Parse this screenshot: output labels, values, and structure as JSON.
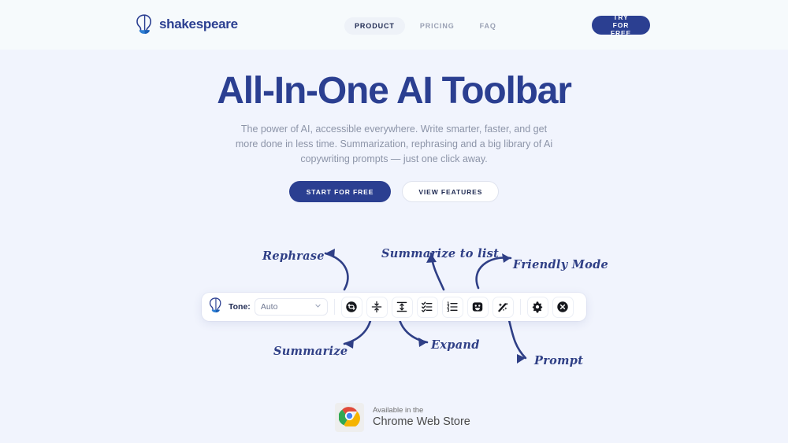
{
  "header": {
    "brand": {
      "name": "shakespeare",
      "logo_icon": "shakespeare-head-icon"
    },
    "nav": [
      {
        "label": "PRODUCT",
        "active": true
      },
      {
        "label": "PRICING",
        "active": false
      },
      {
        "label": "FAQ",
        "active": false
      }
    ],
    "cta_label": "TRY FOR FREE"
  },
  "hero": {
    "title": "All-In-One AI Toolbar",
    "subtitle": "The power of AI, accessible everywhere. Write smarter, faster, and get more done in less time. Summarization, rephrasing and a big library of Ai copywriting prompts — just one click away.",
    "primary_cta": "START FOR FREE",
    "secondary_cta": "VIEW FEATURES"
  },
  "annotations": [
    {
      "label": "Rephrase",
      "name": "annotation-rephrase"
    },
    {
      "label": "Summarize to list",
      "name": "annotation-summarize-to-list"
    },
    {
      "label": "Friendly Mode",
      "name": "annotation-friendly-mode"
    },
    {
      "label": "Summarize",
      "name": "annotation-summarize"
    },
    {
      "label": "Expand",
      "name": "annotation-expand"
    },
    {
      "label": "Prompt",
      "name": "annotation-prompt"
    }
  ],
  "toolbar": {
    "logo_icon": "shakespeare-head-icon",
    "tone_label": "Tone:",
    "tone_value": "Auto",
    "tone_options": [
      "Auto"
    ],
    "buttons": [
      {
        "icon": "rephrase-refresh-icon",
        "tip": "Rephrase"
      },
      {
        "icon": "summarize-shrink-icon",
        "tip": "Summarize"
      },
      {
        "icon": "expand-arrows-icon",
        "tip": "Expand"
      },
      {
        "icon": "checklist-icon",
        "tip": "Summarize to list"
      },
      {
        "icon": "numbered-list-icon",
        "tip": "Numbered list"
      },
      {
        "icon": "smiley-face-icon",
        "tip": "Friendly Mode"
      },
      {
        "icon": "magic-wand-icon",
        "tip": "Prompt"
      },
      {
        "icon": "gear-icon",
        "tip": "Settings"
      },
      {
        "icon": "close-circle-icon",
        "tip": "Close"
      }
    ]
  },
  "chrome_badge": {
    "line1": "Available in the",
    "line2": "Chrome Web Store",
    "icon": "chrome-logo-icon"
  },
  "colors": {
    "brand_navy": "#2b3f91",
    "page_bg": "#f1f4fd",
    "header_bg": "#f6fafc",
    "muted_text": "#8c94a8",
    "annotation_ink": "#2f3f86"
  }
}
